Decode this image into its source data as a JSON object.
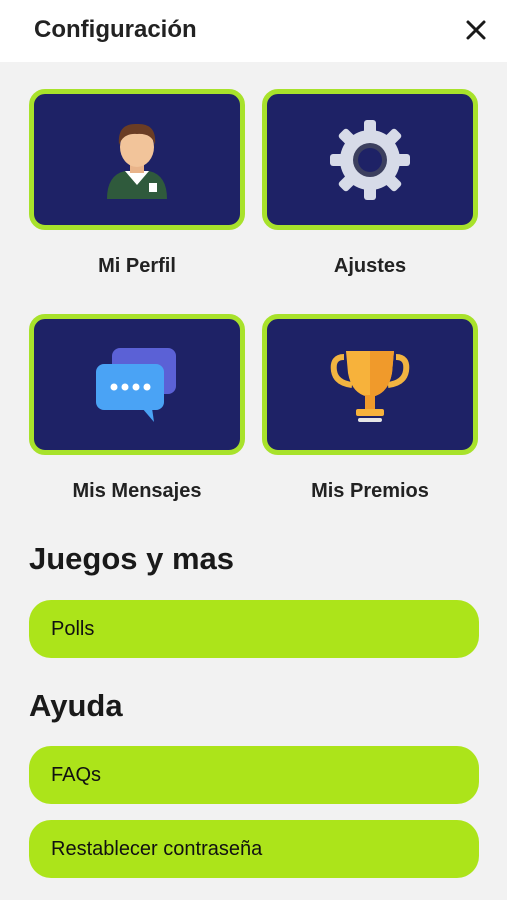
{
  "header": {
    "title": "Configuración",
    "close_icon": "close-icon"
  },
  "cards": [
    {
      "label": "Mi Perfil",
      "icon": "profile-avatar-icon"
    },
    {
      "label": "Ajustes",
      "icon": "gear-icon"
    },
    {
      "label": "Mis Mensajes",
      "icon": "chat-bubbles-icon"
    },
    {
      "label": "Mis Premios",
      "icon": "trophy-icon"
    }
  ],
  "sections": [
    {
      "title": "Juegos y mas",
      "items": [
        "Polls"
      ]
    },
    {
      "title": "Ayuda",
      "items": [
        "FAQs",
        "Restablecer contraseña"
      ]
    }
  ],
  "colors": {
    "card_background": "#1e2266",
    "card_border": "#a8e22b",
    "pill_background": "#ace41a"
  }
}
